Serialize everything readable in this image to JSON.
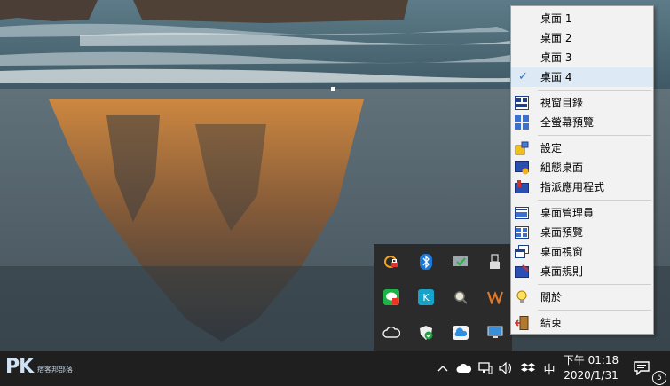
{
  "context_menu": {
    "desktops": [
      {
        "label": "桌面 1",
        "checked": false
      },
      {
        "label": "桌面 2",
        "checked": false
      },
      {
        "label": "桌面 3",
        "checked": false
      },
      {
        "label": "桌面 4",
        "checked": true
      }
    ],
    "group_windows": [
      {
        "label": "視窗目錄",
        "icon": "window-list-icon"
      },
      {
        "label": "全螢幕預覽",
        "icon": "fullscreen-preview-icon"
      }
    ],
    "group_config": [
      {
        "label": "設定",
        "icon": "settings-icon"
      },
      {
        "label": "組態桌面",
        "icon": "configure-desktop-icon"
      },
      {
        "label": "指派應用程式",
        "icon": "assign-app-icon"
      }
    ],
    "group_manage": [
      {
        "label": "桌面管理員",
        "icon": "desktop-manager-icon"
      },
      {
        "label": "桌面預覽",
        "icon": "desktop-preview-icon"
      },
      {
        "label": "桌面視窗",
        "icon": "desktop-windows-icon"
      },
      {
        "label": "桌面規則",
        "icon": "desktop-rules-icon"
      }
    ],
    "about": {
      "label": "關於",
      "icon": "lightbulb-icon"
    },
    "exit": {
      "label": "結束",
      "icon": "exit-door-icon"
    }
  },
  "tray_overflow": [
    "vpn-lock-icon",
    "bluetooth-icon",
    "security-check-icon",
    "usb-eject-icon",
    "line-messenger-icon",
    "kdeconnect-icon",
    "search-tool-icon",
    "app-w-icon",
    "cloud-sync-icon",
    "defender-shield-icon",
    "onedrive-icon",
    "display-monitor-icon"
  ],
  "taskbar": {
    "watermark_logo": "PK",
    "watermark_text": "痞客邦部落",
    "ime_label": "中",
    "clock_time": "下午 01:18",
    "clock_date": "2020/1/31",
    "notification_count": "5"
  },
  "colors": {
    "accent_check": "#2f75c0",
    "menu_bg": "#f2f2f2",
    "taskbar_bg": "#1f1f1f"
  }
}
